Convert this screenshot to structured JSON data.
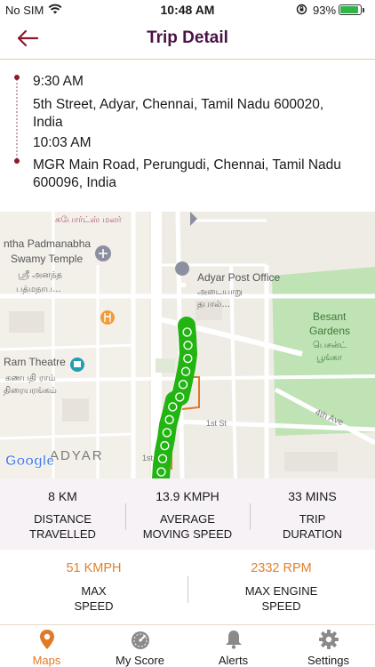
{
  "status_bar": {
    "carrier": "No SIM",
    "time": "10:48 AM",
    "battery": "93%",
    "battery_level": 0.93
  },
  "header": {
    "title": "Trip Detail",
    "back_icon": "arrow-left-icon"
  },
  "route": {
    "start_time": "9:30 AM",
    "start_address_line1": "5th Street, Adyar, Chennai, Tamil Nadu 600020,",
    "start_address_line2": "India",
    "end_time": "10:03 AM",
    "end_address_line1": "MGR Main Road, Perungudi, Chennai, Tamil Nadu",
    "end_address_line2": "600096, India"
  },
  "map": {
    "labels": {
      "temple_en_1": "ntha Padmanabha",
      "temple_en_2": "Swamy Temple",
      "temple_ta_1": "ஸ்ரீ அனந்த",
      "temple_ta_2": "பத்மநாப...",
      "top_ta": "கபோர்ட்ஸ் மலர்",
      "post_office_en": "Adyar Post Office",
      "post_office_ta_1": "அடையாறு",
      "post_office_ta_2": "தபால்...",
      "besant_en_1": "Besant",
      "besant_en_2": "Gardens",
      "besant_ta_1": "பெசன்ட்",
      "besant_ta_2": "பூங்கா",
      "theatre_en": "Ram Theatre",
      "theatre_ta_1": "கணபதி ராம்",
      "theatre_ta_2": "திரையரங்கம்",
      "fourth_ave": "4th Ave",
      "first_st": "1st St",
      "first_st_2": "1st",
      "adyar": "ADYAR",
      "google": "Google"
    },
    "route_color": "#22b512"
  },
  "stats_primary": [
    {
      "value": "8 KM",
      "label_1": "DISTANCE",
      "label_2": "TRAVELLED"
    },
    {
      "value": "13.9 KMPH",
      "label_1": "AVERAGE",
      "label_2": "MOVING SPEED"
    },
    {
      "value": "33 MINS",
      "label_1": "TRIP",
      "label_2": "DURATION"
    }
  ],
  "stats_secondary": [
    {
      "value": "51 KMPH",
      "label_1": "MAX",
      "label_2": "SPEED"
    },
    {
      "value": "2332 RPM",
      "label_1": "MAX ENGINE",
      "label_2": "SPEED"
    }
  ],
  "tabs": [
    {
      "label": "Maps",
      "icon": "map-pin-icon",
      "active": true
    },
    {
      "label": "My Score",
      "icon": "speedometer-icon",
      "active": false
    },
    {
      "label": "Alerts",
      "icon": "bell-icon",
      "active": false
    },
    {
      "label": "Settings",
      "icon": "gear-icon",
      "active": false
    }
  ],
  "colors": {
    "accent": "#e07a26",
    "brand": "#4a1245",
    "route_dot": "#8b1a2b"
  }
}
